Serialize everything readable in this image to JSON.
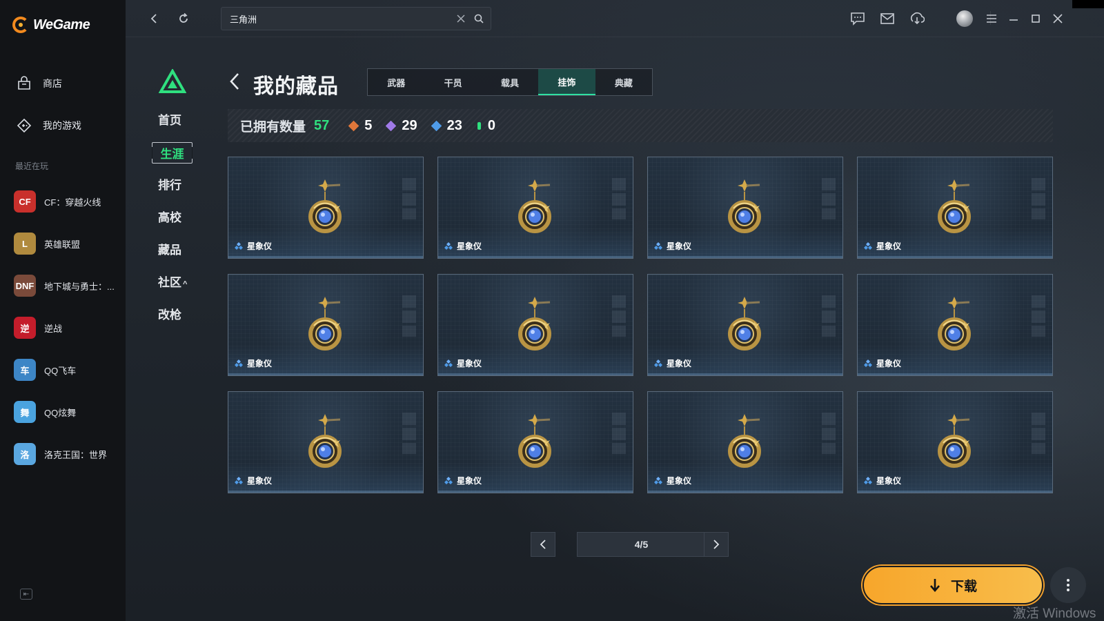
{
  "app": {
    "brand": "WeGame"
  },
  "sidebar": {
    "nav": [
      {
        "label": "商店",
        "icon": "store-icon"
      },
      {
        "label": "我的游戏",
        "icon": "my-games-icon"
      }
    ],
    "recent_label": "最近在玩",
    "games": [
      {
        "name": "CF：穿越火线",
        "icon_text": "CF",
        "color": "#c9302c"
      },
      {
        "name": "英雄联盟",
        "icon_text": "L",
        "color": "#b08a3e"
      },
      {
        "name": "地下城与勇士：...",
        "icon_text": "DNF",
        "color": "#7a4a3a"
      },
      {
        "name": "逆战",
        "icon_text": "逆",
        "color": "#c41d2b"
      },
      {
        "name": "QQ飞车",
        "icon_text": "车",
        "color": "#3d86c6"
      },
      {
        "name": "QQ炫舞",
        "icon_text": "舞",
        "color": "#4aa3df"
      },
      {
        "name": "洛克王国：世界",
        "icon_text": "洛",
        "color": "#5aa7e0"
      }
    ]
  },
  "topbar": {
    "search_value": "三角洲"
  },
  "game_nav": {
    "items": [
      "首页",
      "生涯",
      "排行",
      "高校",
      "藏品",
      "社区",
      "改枪"
    ],
    "active": "生涯",
    "community_suffix": "^"
  },
  "page": {
    "title": "我的藏品",
    "tabs": [
      "武器",
      "干员",
      "载具",
      "挂饰",
      "典藏"
    ],
    "active_tab": "挂饰"
  },
  "owned": {
    "label": "已拥有数量",
    "total": "57",
    "rarities": [
      {
        "count": "5",
        "color": "#e0773a"
      },
      {
        "count": "29",
        "color": "#a07ae8"
      },
      {
        "count": "23",
        "color": "#4f9be8"
      },
      {
        "count": "0",
        "color": "#2fe07f"
      }
    ]
  },
  "items": [
    {
      "name": "星象仪"
    },
    {
      "name": "星象仪"
    },
    {
      "name": "星象仪"
    },
    {
      "name": "星象仪"
    },
    {
      "name": "星象仪"
    },
    {
      "name": "星象仪"
    },
    {
      "name": "星象仪"
    },
    {
      "name": "星象仪"
    },
    {
      "name": "星象仪"
    },
    {
      "name": "星象仪"
    },
    {
      "name": "星象仪"
    },
    {
      "name": "星象仪"
    }
  ],
  "pagination": {
    "current": 4,
    "total": 5,
    "label": "4/5"
  },
  "download": {
    "label": "下载"
  },
  "watermark": "激活 Windows",
  "colors": {
    "accent_green": "#2fe07f",
    "download_orange": "#f7a62b"
  }
}
